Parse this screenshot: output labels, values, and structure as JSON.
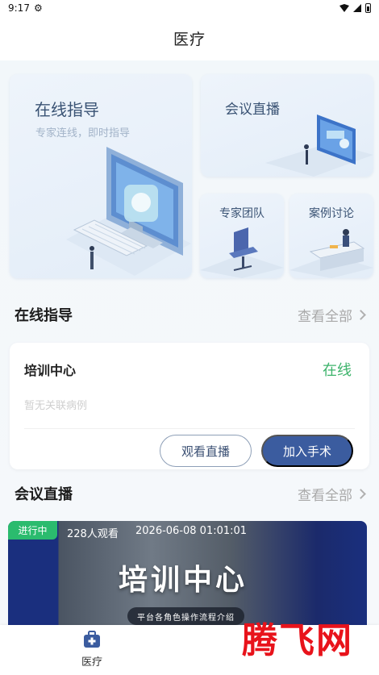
{
  "status_bar": {
    "time": "9:17",
    "settings_glyph": "⚙"
  },
  "header": {
    "title": "医疗"
  },
  "tiles": {
    "online_guidance": {
      "title": "在线指导",
      "subtitle": "专家连线，即时指导"
    },
    "meeting_live": {
      "title": "会议直播"
    },
    "expert_team": {
      "title": "专家团队"
    },
    "case_discussion": {
      "title": "案例讨论"
    }
  },
  "guidance_section": {
    "title": "在线指导",
    "more_label": "查看全部"
  },
  "guidance_card": {
    "title": "培训中心",
    "status": "在线",
    "note": "暂无关联病例",
    "watch_button": "观看直播",
    "join_button": "加入手术"
  },
  "live_section": {
    "title": "会议直播",
    "more_label": "查看全部"
  },
  "live_card": {
    "badge": "进行中",
    "viewers": "228人观看",
    "start_time": "2026-06-08 01:01:01",
    "banner_title": "培训中心",
    "banner_subtitle": "平台各角色操作流程介绍"
  },
  "tabbar": {
    "items": [
      {
        "label": "医疗",
        "icon": "medical-kit-icon",
        "active": true
      }
    ]
  },
  "watermark": {
    "text": "腾飞网"
  },
  "colors": {
    "primary": "#3b5c9f",
    "online_green": "#3db36b",
    "badge_green": "#2bbb6e",
    "watermark_red": "#e8131b"
  }
}
